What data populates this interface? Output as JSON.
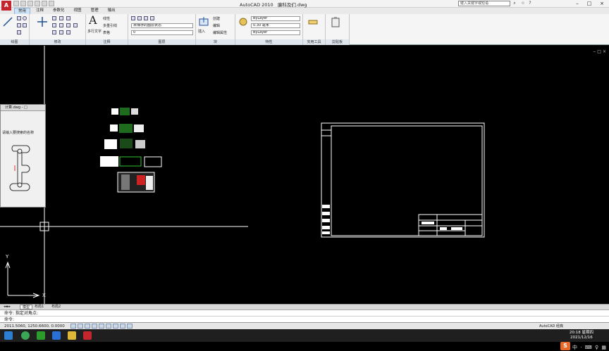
{
  "app": {
    "title": "AutoCAD 2010",
    "document": "廉科及们.dwg",
    "logo_letter": "A"
  },
  "search": {
    "placeholder": "键入关键字或短语"
  },
  "window_controls": {
    "minimize": "–",
    "restore": "□",
    "close": "×"
  },
  "tabs": [
    "常用",
    "注释",
    "参数化",
    "视图",
    "管理",
    "输出"
  ],
  "active_tab": "常用",
  "ribbon": {
    "panels": [
      {
        "id": "draw",
        "title": "绘图"
      },
      {
        "id": "modify",
        "title": "修改"
      },
      {
        "id": "annotation",
        "title": "注释"
      },
      {
        "id": "layers",
        "title": "图层"
      },
      {
        "id": "block",
        "title": "块"
      },
      {
        "id": "properties",
        "title": "特性"
      },
      {
        "id": "utilities",
        "title": "实用工具"
      },
      {
        "id": "clipboard",
        "title": "剪贴板"
      }
    ],
    "annotation": {
      "text_label": "多行文字",
      "dimension": "线性",
      "leader": "多重引线",
      "table": "表格"
    },
    "layers": {
      "state": "未保存的图层状态",
      "layer_name": "0"
    },
    "block": {
      "insert_label": "插入",
      "create": "创建",
      "edit": "编辑",
      "edit_attr": "编辑属性"
    },
    "properties": {
      "color": "ByLayer",
      "lineweight": "0.30 毫米",
      "linetype": "ByLayer"
    }
  },
  "palette": {
    "header": "计算.dwg - □",
    "text": "请输入要搜索的名称"
  },
  "model_tabs": [
    "模型",
    "布局1",
    "布局2"
  ],
  "command": {
    "line1": "命令: 指定对角点:",
    "line2": "命令:"
  },
  "status": {
    "coords": "2011.5060, 1250.6600, 0.0000",
    "workspace": "AutoCAD 经典"
  },
  "ime": {
    "badge": "S",
    "icons": "中 · ⌨ ♀ ▦"
  },
  "clock": {
    "time": "20:18",
    "day": "星期四",
    "date": "2021/12/16"
  },
  "colors": {
    "title_blue": "#1a4f9c",
    "canvas": "#000000",
    "drawing_lines": "#ffffff",
    "crosshair": "#ffffff",
    "ime_orange": "#e8682a"
  },
  "icons": [
    "new-icon",
    "open-icon",
    "save-icon",
    "undo-icon",
    "redo-icon",
    "search-icon",
    "line-icon",
    "polyline-icon",
    "circle-icon",
    "arc-icon",
    "move-icon",
    "copy-icon",
    "insert-icon",
    "layer-icon",
    "match-icon",
    "paste-icon",
    "windows-icon",
    "chrome-icon",
    "explorer-icon",
    "autocad-icon"
  ]
}
